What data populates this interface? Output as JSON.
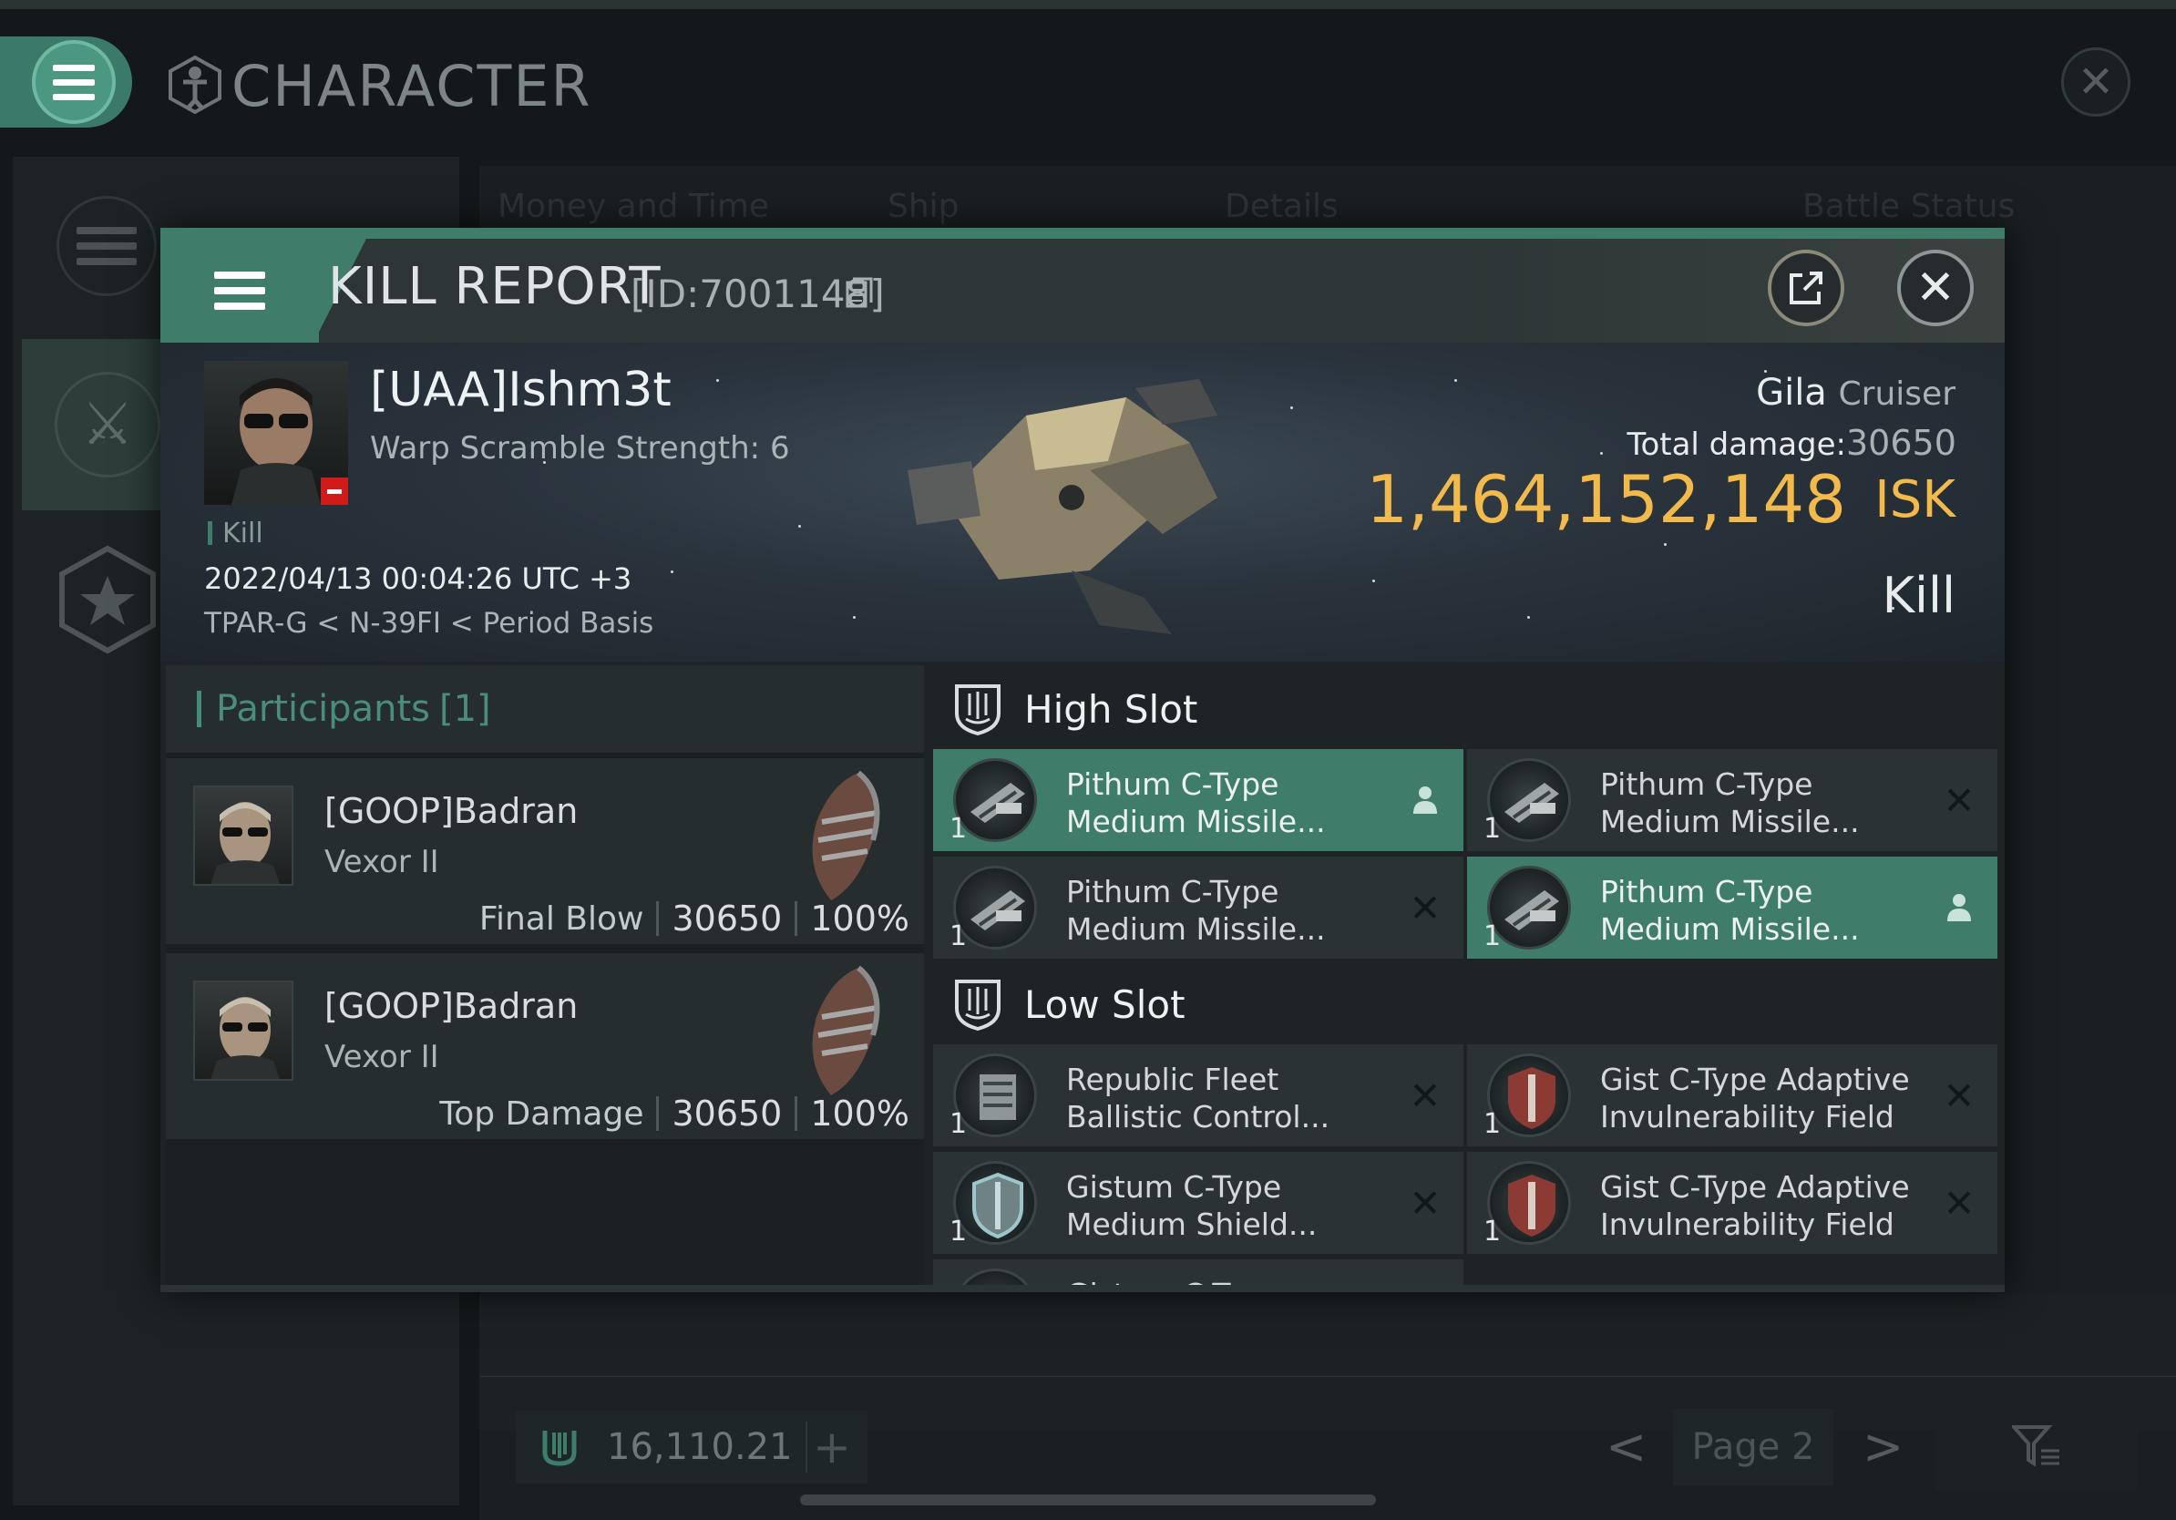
{
  "app": {
    "title": "CHARACTER",
    "columns": [
      "Money and Time",
      "Ship",
      "Details",
      "Battle Status"
    ],
    "wallet_value": "16,110.21",
    "page_label": "Page 2"
  },
  "kill_report": {
    "title": "KILL REPORT",
    "report_id": "[ID:7001148]",
    "victim": {
      "name": "[UAA]Ishm3t",
      "detail": "Warp Scramble Strength: 6",
      "tag": "Kill",
      "datetime": "2022/04/13 00:04:26 UTC +3",
      "location": "TPAR-G < N-39FI < Period Basis"
    },
    "ship": {
      "name": "Gila",
      "class": "Cruiser",
      "total_damage_label": "Total damage:",
      "total_damage": "30650",
      "isk_value": "1,464,152,148",
      "isk_unit": "ISK",
      "status": "Kill"
    },
    "participants": {
      "label": "Participants",
      "count": "[1]",
      "rows": [
        {
          "name": "[GOOP]Badran",
          "ship": "Vexor II",
          "stat_label": "Final Blow",
          "damage": "30650",
          "percent": "100%"
        },
        {
          "name": "[GOOP]Badran",
          "ship": "Vexor II",
          "stat_label": "Top Damage",
          "damage": "30650",
          "percent": "100%"
        }
      ]
    },
    "high_slot": {
      "label": "High Slot",
      "items": [
        {
          "qty": "1",
          "name": "Pithum C-Type Medium Missile...",
          "state": "dropped"
        },
        {
          "qty": "1",
          "name": "Pithum C-Type Medium Missile...",
          "state": "destroyed"
        },
        {
          "qty": "1",
          "name": "Pithum C-Type Medium Missile...",
          "state": "destroyed"
        },
        {
          "qty": "1",
          "name": "Pithum C-Type Medium Missile...",
          "state": "dropped"
        }
      ]
    },
    "low_slot": {
      "label": "Low Slot",
      "items": [
        {
          "qty": "1",
          "name": "Republic Fleet Ballistic Control...",
          "state": "destroyed"
        },
        {
          "qty": "1",
          "name": "Gist C-Type Adaptive Invulnerability Field",
          "state": "destroyed"
        },
        {
          "qty": "1",
          "name": "Gistum C-Type Medium Shield...",
          "state": "destroyed"
        },
        {
          "qty": "1",
          "name": "Gist C-Type Adaptive Invulnerability Field",
          "state": "destroyed"
        },
        {
          "qty": "",
          "name": "Gistum C-Type",
          "state": ""
        }
      ]
    }
  },
  "colors": {
    "accent": "#3f7c6a",
    "isk_gold": "#f2b94c",
    "corp_badge": "#d11b1b"
  },
  "icons": {
    "destroyed": "close-x",
    "dropped": "person-icon"
  }
}
